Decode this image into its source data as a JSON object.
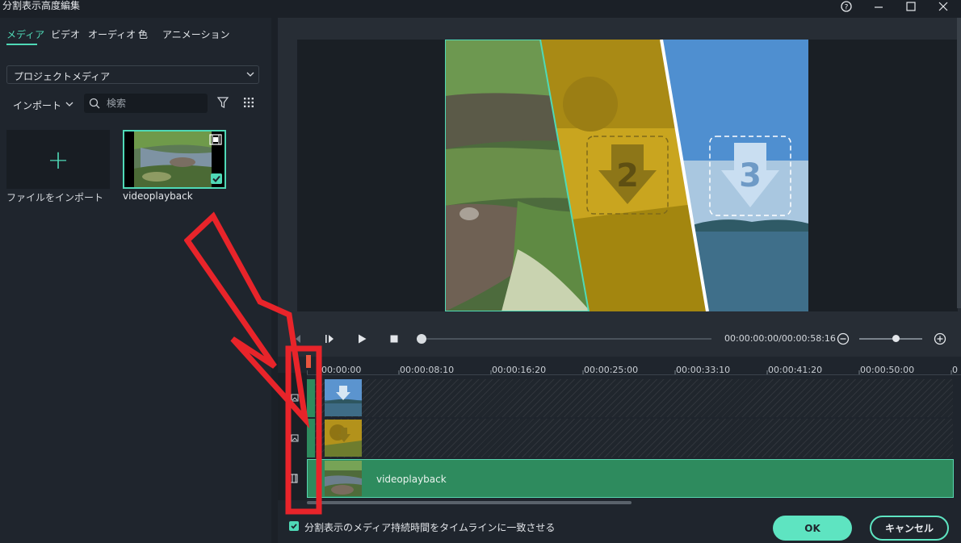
{
  "window": {
    "title": "分割表示高度編集"
  },
  "tabs": [
    {
      "label": "メディア",
      "active": true
    },
    {
      "label": "ビデオ",
      "active": false
    },
    {
      "label": "オーディオ",
      "active": false
    },
    {
      "label": "色",
      "active": false
    },
    {
      "label": "アニメーション",
      "active": false
    }
  ],
  "media": {
    "dropdown_value": "プロジェクトメディア",
    "import_label": "インポート",
    "search_placeholder": "検索",
    "import_tile_label": "ファイルをインポート",
    "item_label": "videoplayback"
  },
  "preview": {
    "slot2_number": "2",
    "slot3_number": "3"
  },
  "player": {
    "timecode": "00:00:00:00/00:00:58:16",
    "progress": 0.0
  },
  "timeline": {
    "ruler_ticks": [
      "00:00:00",
      "00:00:08:10",
      "00:00:16:20",
      "00:00:25:00",
      "00:00:33:10",
      "00:00:41:20",
      "00:00:50:00",
      "0"
    ],
    "main_clip_label": "videoplayback"
  },
  "footer": {
    "checkbox_label": "分割表示のメディア持続時間をタイムラインに一致させる",
    "checkbox_checked": true,
    "ok_label": "OK",
    "cancel_label": "キャンセル"
  },
  "colors": {
    "accent": "#4fd9b6",
    "clip_green": "#2e8b5e",
    "annotation_red": "#e8242a"
  }
}
